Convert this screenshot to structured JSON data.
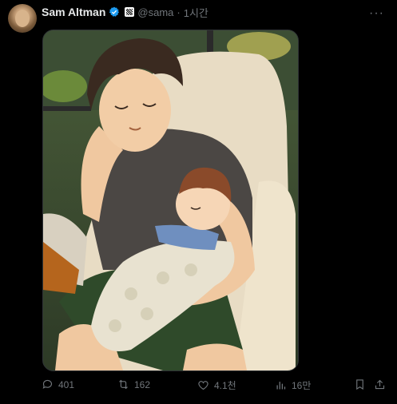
{
  "post": {
    "author_name": "Sam Altman",
    "handle": "@sama",
    "separator": "·",
    "time": "1시간",
    "more_label": "···"
  },
  "actions": {
    "replies": "401",
    "reposts": "162",
    "likes": "4.1천",
    "views": "16만"
  },
  "icons": {
    "verified": "verified-badge-icon",
    "affiliation": "affiliation-badge-icon",
    "reply": "reply-icon",
    "repost": "repost-icon",
    "like": "heart-icon",
    "views": "views-icon",
    "bookmark": "bookmark-icon",
    "share": "share-icon"
  },
  "colors": {
    "background": "#000000",
    "text_primary": "#e7e9ea",
    "text_secondary": "#71767b",
    "verified_blue": "#1d9bf0"
  }
}
